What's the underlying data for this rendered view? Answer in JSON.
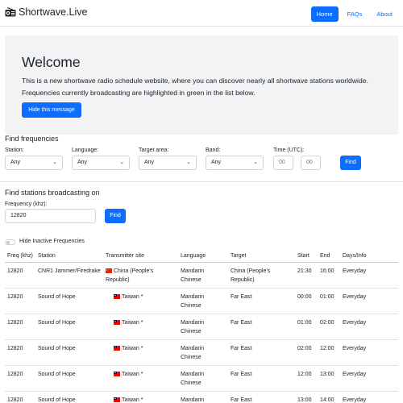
{
  "navbar": {
    "brand": "Shortwave.Live",
    "links": [
      {
        "label": "Home",
        "active": true
      },
      {
        "label": "FAQs",
        "active": false
      },
      {
        "label": "About",
        "active": false
      }
    ]
  },
  "welcome": {
    "title": "Welcome",
    "text": "This is a new shortwave radio schedule website, where you can discover nearly all shortwave stations worldwide. Frequencies currently broadcasting are highlighted in green in the list below.",
    "hide_button": "Hide this message"
  },
  "find_frequencies": {
    "title": "Find frequencies",
    "station": {
      "label": "Station:",
      "value": "Any"
    },
    "language": {
      "label": "Language:",
      "value": "Any"
    },
    "target": {
      "label": "Target area:",
      "value": "Any"
    },
    "band": {
      "label": "Band:",
      "value": "Any"
    },
    "time": {
      "label": "Time (UTC):",
      "from_placeholder": "00",
      "to_placeholder": "00"
    },
    "find_button": "Find"
  },
  "find_stations": {
    "title": "Find stations broadcasting on",
    "freq_label": "Frequency (khz):",
    "freq_value": "12820",
    "find_button": "Find"
  },
  "toggle": {
    "label": "Hide Inactive Frequencies",
    "on": false
  },
  "table": {
    "headers": {
      "freq": "Freq (khz)",
      "station": "Station",
      "site": "Transmitter site",
      "language": "Language",
      "target": "Target",
      "start": "Start",
      "end": "End",
      "days": "Days/Info"
    },
    "rows": [
      {
        "freq": "12820",
        "station": "CNR1 Jammer/Firedrake",
        "site": "China (People's Republic)",
        "language": "Mandarin Chinese",
        "target": "China (People's Republic)",
        "start": "21:30",
        "end": "16:00",
        "days": "Everyday"
      },
      {
        "freq": "12820",
        "station": "Sound of Hope",
        "site": "Taiwan *",
        "language": "Mandarin Chinese",
        "target": "Far East",
        "start": "00:00",
        "end": "01:00",
        "days": "Everyday"
      },
      {
        "freq": "12820",
        "station": "Sound of Hope",
        "site": "Taiwan *",
        "language": "Mandarin Chinese",
        "target": "Far East",
        "start": "01:00",
        "end": "02:00",
        "days": "Everyday"
      },
      {
        "freq": "12820",
        "station": "Sound of Hope",
        "site": "Taiwan *",
        "language": "Mandarin Chinese",
        "target": "Far East",
        "start": "02:00",
        "end": "12:00",
        "days": "Everyday"
      },
      {
        "freq": "12820",
        "station": "Sound of Hope",
        "site": "Taiwan *",
        "language": "Mandarin Chinese",
        "target": "Far East",
        "start": "12:00",
        "end": "13:00",
        "days": "Everyday"
      },
      {
        "freq": "12820",
        "station": "Sound of Hope",
        "site": "Taiwan *",
        "language": "Mandarin Chinese",
        "target": "Far East",
        "start": "13:00",
        "end": "14:00",
        "days": "Everyday"
      }
    ]
  },
  "colors": {
    "primary": "#0d6efd",
    "jumbotron": "#f1f3f5"
  }
}
